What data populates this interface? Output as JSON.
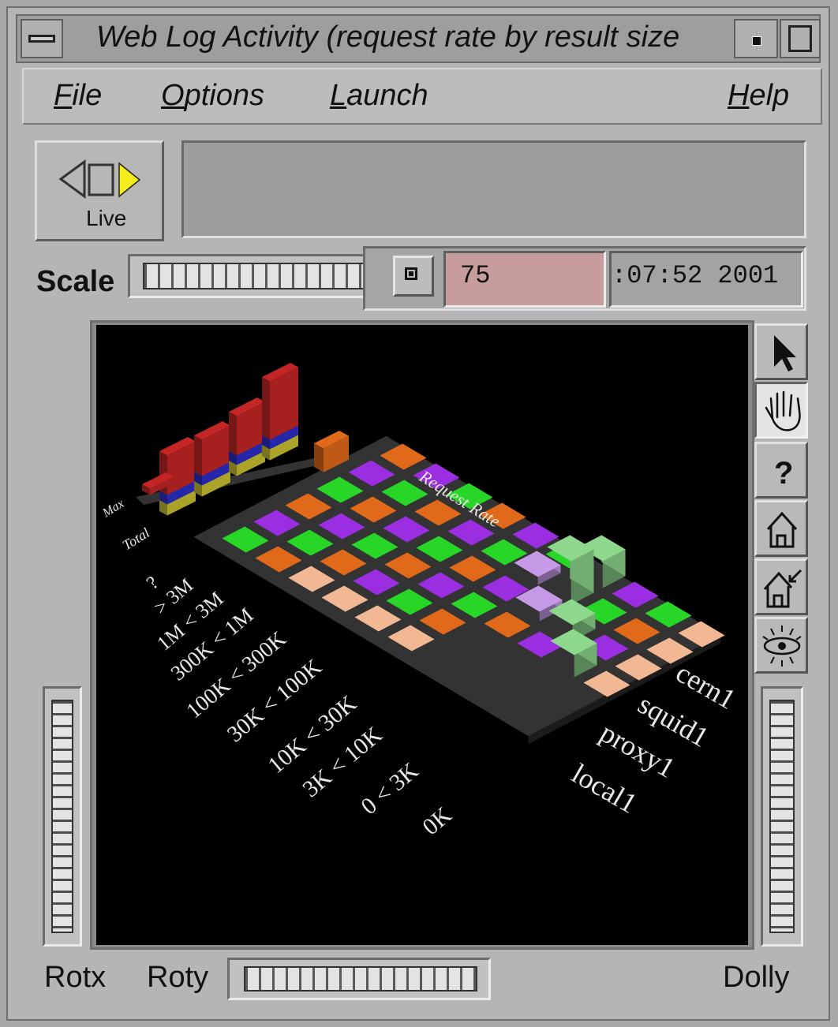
{
  "window": {
    "title": "Web Log Activity (request rate by result size"
  },
  "menu": {
    "file": {
      "mnemonic": "F",
      "rest": "ile"
    },
    "options": {
      "mnemonic": "O",
      "rest": "ptions"
    },
    "launch": {
      "mnemonic": "L",
      "rest": "aunch"
    },
    "help": {
      "mnemonic": "H",
      "rest": "elp"
    }
  },
  "vcr": {
    "mode_label": "Live",
    "play_color": "#f4ec1c"
  },
  "scale": {
    "label": "Scale",
    "value": "75"
  },
  "time_display": ":07:52 2001",
  "viewer": {
    "background": "#000000",
    "side_labels": [
      "Max",
      "Total"
    ],
    "axis_title": "Request Rate",
    "size_buckets": [
      "?",
      "> 3M",
      "1M < 3M",
      "300K < 1M",
      "100K < 300K",
      "30K < 100K",
      "10K < 30K",
      "3K < 10K",
      "0 < 3K",
      "0K"
    ],
    "hosts": [
      "cern1",
      "squid1",
      "proxy1",
      "local1"
    ],
    "colors": {
      "red": "#c42626",
      "orange": "#e06a1a",
      "purple": "#9a2ee0",
      "green": "#28d628",
      "light_green": "#8ed88e",
      "light_purple": "#c79ae8",
      "tan": "#f2b894",
      "yellow": "#c9c030",
      "blue": "#2d2dc9"
    }
  },
  "toolbar": {
    "tools": [
      "pointer-icon",
      "hand-icon",
      "help-icon",
      "home-icon",
      "set-home-icon",
      "eye-icon"
    ]
  },
  "bottom": {
    "rotx": "Rotx",
    "roty": "Roty",
    "dolly": "Dolly"
  }
}
